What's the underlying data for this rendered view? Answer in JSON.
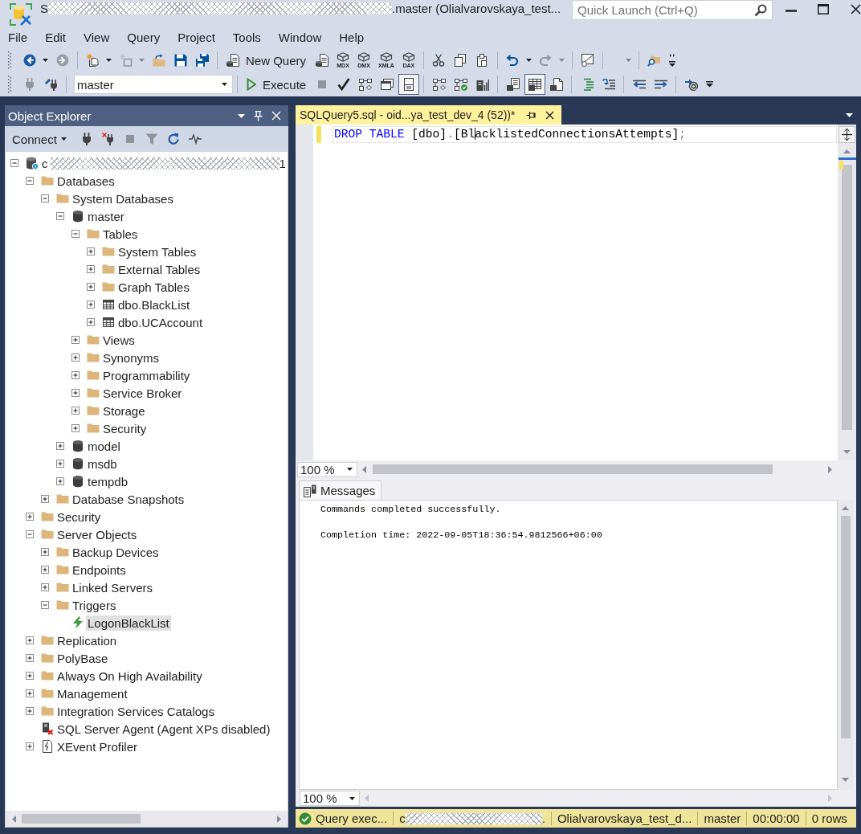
{
  "window": {
    "title_start": "S",
    "title_end": ".master (Olialvarovskaya_test...",
    "quick_launch": {
      "placeholder": "Quick Launch (Ctrl+Q)"
    }
  },
  "menu": [
    {
      "label": "File"
    },
    {
      "label": "Edit"
    },
    {
      "label": "View"
    },
    {
      "label": "Query"
    },
    {
      "label": "Project"
    },
    {
      "label": "Tools"
    },
    {
      "label": "Window"
    },
    {
      "label": "Help"
    }
  ],
  "toolbar_standard": [
    {
      "kind": "gripper"
    },
    {
      "kind": "icon",
      "disabled": false
    },
    {
      "kind": "menu_arrow",
      "disabled": false
    },
    {
      "kind": "icon",
      "disabled": true
    },
    {
      "kind": "separator"
    },
    {
      "kind": "icon",
      "disabled": false
    },
    {
      "kind": "menu_arrow",
      "disabled": false
    },
    {
      "kind": "icon",
      "disabled": true
    },
    {
      "kind": "menu_arrow",
      "disabled": true
    },
    {
      "kind": "icon",
      "disabled": false
    },
    {
      "kind": "icon",
      "disabled": false
    },
    {
      "kind": "icon",
      "disabled": false
    },
    {
      "kind": "separator"
    },
    {
      "kind": "text_button",
      "label": "New Query"
    },
    {
      "kind": "icon",
      "disabled": false
    },
    {
      "kind": "labeled_icon",
      "label": "MDX"
    },
    {
      "kind": "labeled_icon",
      "label": "DMX"
    },
    {
      "kind": "labeled_icon",
      "label": "XMLA"
    },
    {
      "kind": "labeled_icon",
      "label": "DAX"
    },
    {
      "kind": "separator"
    },
    {
      "kind": "icon",
      "disabled": false
    },
    {
      "kind": "icon",
      "disabled": false
    },
    {
      "kind": "icon",
      "disabled": false
    },
    {
      "kind": "separator"
    },
    {
      "kind": "icon",
      "disabled": false
    },
    {
      "kind": "menu_arrow",
      "disabled": false
    },
    {
      "kind": "icon",
      "disabled": true
    },
    {
      "kind": "menu_arrow",
      "disabled": true
    },
    {
      "kind": "separator"
    },
    {
      "kind": "icon",
      "disabled": false
    },
    {
      "kind": "separator"
    },
    {
      "kind": "empty_combo",
      "disabled": true
    },
    {
      "kind": "separator"
    },
    {
      "kind": "icon",
      "disabled": false
    },
    {
      "kind": "overflow"
    }
  ],
  "toolbar_editor": [
    {
      "kind": "gripper"
    },
    {
      "kind": "icon",
      "disabled": true,
      "pressed": false
    },
    {
      "kind": "icon",
      "disabled": false,
      "pressed": false
    },
    {
      "kind": "separator"
    },
    {
      "kind": "combo",
      "value": "master"
    },
    {
      "kind": "separator"
    },
    {
      "kind": "text_button",
      "label": "Execute"
    },
    {
      "kind": "icon",
      "disabled": true,
      "pressed": false
    },
    {
      "kind": "icon",
      "disabled": false,
      "pressed": false
    },
    {
      "kind": "icon",
      "disabled": false,
      "pressed": false
    },
    {
      "kind": "icon",
      "disabled": false,
      "pressed": false
    },
    {
      "kind": "icon",
      "disabled": false,
      "pressed": true
    },
    {
      "kind": "separator"
    },
    {
      "kind": "icon",
      "disabled": false,
      "pressed": false
    },
    {
      "kind": "icon",
      "disabled": false,
      "pressed": false
    },
    {
      "kind": "icon",
      "disabled": false,
      "pressed": false
    },
    {
      "kind": "separator"
    },
    {
      "kind": "icon",
      "disabled": false,
      "pressed": false
    },
    {
      "kind": "icon",
      "disabled": false,
      "pressed": true
    },
    {
      "kind": "icon",
      "disabled": false,
      "pressed": false
    },
    {
      "kind": "separator"
    },
    {
      "kind": "icon",
      "disabled": false,
      "pressed": false
    },
    {
      "kind": "icon",
      "disabled": false,
      "pressed": false
    },
    {
      "kind": "separator"
    },
    {
      "kind": "icon",
      "disabled": false,
      "pressed": false
    },
    {
      "kind": "icon",
      "disabled": false,
      "pressed": false
    },
    {
      "kind": "separator"
    },
    {
      "kind": "icon",
      "disabled": false,
      "pressed": false
    },
    {
      "kind": "overflow"
    }
  ],
  "object_explorer": {
    "title": "Object Explorer",
    "toolbar": [
      {
        "kind": "text_menu",
        "label": "Connect"
      },
      {
        "kind": "icon",
        "disabled": false
      },
      {
        "kind": "icon",
        "disabled": false
      },
      {
        "kind": "icon",
        "disabled": true
      },
      {
        "kind": "icon",
        "disabled": true
      },
      {
        "kind": "icon",
        "disabled": false
      },
      {
        "kind": "icon",
        "disabled": false
      }
    ],
    "tree": [
      {
        "kind": "server",
        "label_start": "c",
        "label_end": "1",
        "expanded": true,
        "selected": false,
        "children": [
          {
            "kind": "folder",
            "label": "Databases",
            "expanded": true,
            "selected": false,
            "children": [
              {
                "kind": "folder",
                "label": "System Databases",
                "expanded": true,
                "selected": false,
                "children": [
                  {
                    "kind": "database",
                    "label": "master",
                    "expanded": true,
                    "selected": false,
                    "children": [
                      {
                        "kind": "folder",
                        "label": "Tables",
                        "expanded": true,
                        "selected": false,
                        "children": [
                          {
                            "kind": "folder",
                            "label": "System Tables",
                            "expanded": false,
                            "selected": false
                          },
                          {
                            "kind": "folder",
                            "label": "External Tables",
                            "expanded": false,
                            "selected": false
                          },
                          {
                            "kind": "folder",
                            "label": "Graph Tables",
                            "expanded": false,
                            "selected": false
                          },
                          {
                            "kind": "table",
                            "label": "dbo.BlackList",
                            "expanded": false,
                            "selected": false
                          },
                          {
                            "kind": "table",
                            "label": "dbo.UCAccount",
                            "expanded": false,
                            "selected": false
                          }
                        ]
                      },
                      {
                        "kind": "folder",
                        "label": "Views",
                        "expanded": false,
                        "selected": false
                      },
                      {
                        "kind": "folder",
                        "label": "Synonyms",
                        "expanded": false,
                        "selected": false
                      },
                      {
                        "kind": "folder",
                        "label": "Programmability",
                        "expanded": false,
                        "selected": false
                      },
                      {
                        "kind": "folder",
                        "label": "Service Broker",
                        "expanded": false,
                        "selected": false
                      },
                      {
                        "kind": "folder",
                        "label": "Storage",
                        "expanded": false,
                        "selected": false
                      },
                      {
                        "kind": "folder",
                        "label": "Security",
                        "expanded": false,
                        "selected": false
                      }
                    ]
                  },
                  {
                    "kind": "database",
                    "label": "model",
                    "expanded": false,
                    "selected": false
                  },
                  {
                    "kind": "database",
                    "label": "msdb",
                    "expanded": false,
                    "selected": false
                  },
                  {
                    "kind": "database",
                    "label": "tempdb",
                    "expanded": false,
                    "selected": false
                  }
                ]
              },
              {
                "kind": "folder",
                "label": "Database Snapshots",
                "expanded": false,
                "selected": false
              }
            ]
          },
          {
            "kind": "folder",
            "label": "Security",
            "expanded": false,
            "selected": false
          },
          {
            "kind": "folder",
            "label": "Server Objects",
            "expanded": true,
            "selected": false,
            "children": [
              {
                "kind": "folder",
                "label": "Backup Devices",
                "expanded": false,
                "selected": false
              },
              {
                "kind": "folder",
                "label": "Endpoints",
                "expanded": false,
                "selected": false
              },
              {
                "kind": "folder",
                "label": "Linked Servers",
                "expanded": false,
                "selected": false
              },
              {
                "kind": "folder",
                "label": "Triggers",
                "expanded": true,
                "selected": false,
                "children": [
                  {
                    "kind": "trigger",
                    "label": "LogonBlackList",
                    "selected": true
                  }
                ]
              }
            ]
          },
          {
            "kind": "folder",
            "label": "Replication",
            "expanded": false,
            "selected": false
          },
          {
            "kind": "folder",
            "label": "PolyBase",
            "expanded": false,
            "selected": false
          },
          {
            "kind": "folder",
            "label": "Always On High Availability",
            "expanded": false,
            "selected": false
          },
          {
            "kind": "folder",
            "label": "Management",
            "expanded": false,
            "selected": false
          },
          {
            "kind": "folder",
            "label": "Integration Services Catalogs",
            "expanded": false,
            "selected": false
          },
          {
            "kind": "agent",
            "label": "SQL Server Agent (Agent XPs disabled)",
            "selected": false
          },
          {
            "kind": "xevent",
            "label": "XEvent Profiler",
            "expanded": false,
            "selected": false
          }
        ]
      }
    ]
  },
  "editor": {
    "tabs": [
      {
        "label": "SQLQuery5.sql - oid...ya_test_dev_4 (52))*",
        "selected": true
      }
    ],
    "code": [
      {
        "kind": "keyword",
        "text": "DROP TABLE"
      },
      {
        "kind": "plain",
        "text": " [dbo]"
      },
      {
        "kind": "operator",
        "text": "."
      },
      {
        "kind": "plain",
        "text": "[Bl"
      },
      {
        "kind": "caret"
      },
      {
        "kind": "plain",
        "text": "acklistedConnectionsAttempts]"
      },
      {
        "kind": "operator",
        "text": ";"
      }
    ],
    "zoom": "100 %"
  },
  "results": {
    "tabs": [
      {
        "label": "Messages",
        "selected": true
      }
    ],
    "messages": [
      "Commands completed successfully.",
      "Completion time: 2022-09-05T18:36:54.9812566+06:00"
    ],
    "zoom": "100 %"
  },
  "status_bar": [
    {
      "kind": "status",
      "text": "Query exec..."
    },
    {
      "kind": "redacted",
      "text_start": "c",
      "text_end": "."
    },
    {
      "kind": "text",
      "text": "Olialvarovskaya_test_d..."
    },
    {
      "kind": "text",
      "text": "master"
    },
    {
      "kind": "text",
      "text": "00:00:00"
    },
    {
      "kind": "text",
      "text": "0 rows"
    }
  ]
}
